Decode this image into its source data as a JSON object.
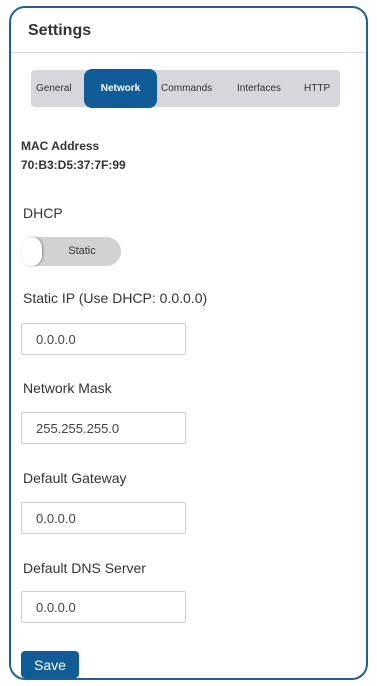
{
  "settings": {
    "title": "Settings",
    "tabs": [
      {
        "label": "General",
        "active": false
      },
      {
        "label": "Network",
        "active": true
      },
      {
        "label": "Commands",
        "active": false
      },
      {
        "label": "Interfaces",
        "active": false
      },
      {
        "label": "HTTP",
        "active": false
      }
    ]
  },
  "network": {
    "mac_label": "MAC Address",
    "mac_value": "70:B3:D5:37:7F:99",
    "dhcp_label": "DHCP",
    "dhcp_toggle_label": "Static",
    "dhcp_enabled": false,
    "static_ip_label": "Static IP (Use DHCP: 0.0.0.0)",
    "static_ip_value": "0.0.0.0",
    "netmask_label": "Network Mask",
    "netmask_value": "255.255.255.0",
    "gateway_label": "Default Gateway",
    "gateway_value": "0.0.0.0",
    "dns_label": "Default DNS Server",
    "dns_value": "0.0.0.0",
    "save_label": "Save"
  },
  "colors": {
    "accent": "#0f5c96",
    "border": "#1f5f99",
    "tabbar": "#d6d6dc",
    "toggle": "#d2d2d2"
  }
}
